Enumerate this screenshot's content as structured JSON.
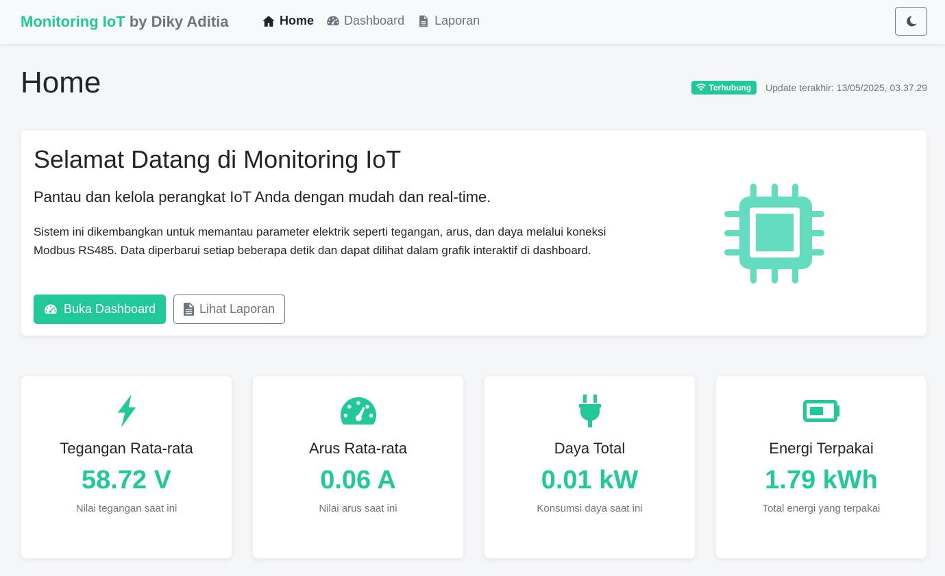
{
  "navbar": {
    "brand_accent": "Monitoring IoT",
    "brand_rest": "by Diky Aditia",
    "items": [
      {
        "label": "Home",
        "icon": "home-icon",
        "active": true
      },
      {
        "label": "Dashboard",
        "icon": "gauge-icon",
        "active": false
      },
      {
        "label": "Laporan",
        "icon": "file-icon",
        "active": false
      }
    ],
    "theme_toggle_icon": "moon-icon"
  },
  "header": {
    "title": "Home",
    "status_badge": "Terhubung",
    "update_text": "Update terakhir: 13/05/2025, 03.37.29"
  },
  "hero": {
    "title": "Selamat Datang di Monitoring IoT",
    "lead": "Pantau dan kelola perangkat IoT Anda dengan mudah dan real-time.",
    "description": "Sistem ini dikembangkan untuk memantau parameter elektrik seperti tegangan, arus, dan daya melalui koneksi Modbus RS485. Data diperbarui setiap beberapa detik dan dapat dilihat dalam grafik interaktif di dashboard.",
    "primary_button": "Buka Dashboard",
    "secondary_button": "Lihat Laporan",
    "illustration_icon": "cpu-chip-icon"
  },
  "stats": [
    {
      "icon": "lightning-icon",
      "label": "Tegangan Rata-rata",
      "value": "58.72 V",
      "sub": "Nilai tegangan saat ini"
    },
    {
      "icon": "speedometer-icon",
      "label": "Arus Rata-rata",
      "value": "0.06 A",
      "sub": "Nilai arus saat ini"
    },
    {
      "icon": "plug-icon",
      "label": "Daya Total",
      "value": "0.01 kW",
      "sub": "Konsumsi daya saat ini"
    },
    {
      "icon": "battery-icon",
      "label": "Energi Terpakai",
      "value": "1.79 kWh",
      "sub": "Total energi yang terpakai"
    }
  ],
  "colors": {
    "accent": "#20c997",
    "text": "#212529",
    "muted": "#6c757d",
    "background": "#f5f6f8"
  }
}
